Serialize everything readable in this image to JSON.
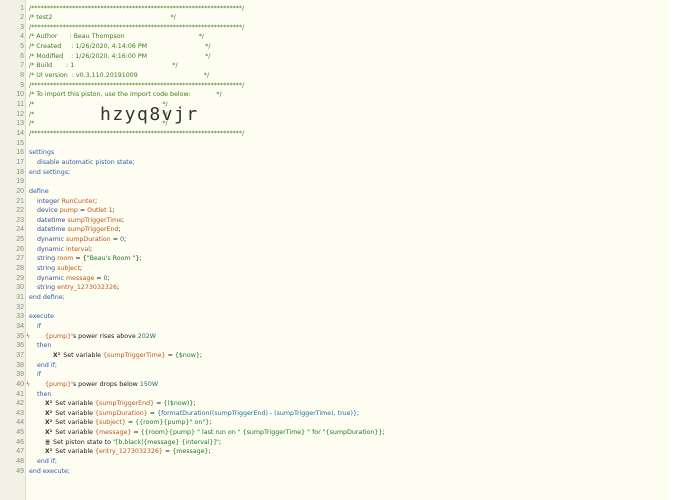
{
  "import_code": "hzyq8vjr",
  "lines": [
    {
      "n": "1",
      "text": "/*******************************************************************/",
      "cls": "cm"
    },
    {
      "n": "2",
      "text": "/* test2                                                           */",
      "cls": "cm"
    },
    {
      "n": "3",
      "text": "/*******************************************************************/",
      "cls": "cm"
    },
    {
      "n": "4",
      "text": "/* Author      : Beau Thompson                                     */",
      "cls": "cm"
    },
    {
      "n": "5",
      "text": "/* Created     : 1/26/2020, 4:14:06 PM                             */",
      "cls": "cm"
    },
    {
      "n": "6",
      "text": "/* Modified    : 1/26/2020, 4:16:00 PM                             */",
      "cls": "cm"
    },
    {
      "n": "7",
      "text": "/* Build       : 1                                                 */",
      "cls": "cm"
    },
    {
      "n": "8",
      "text": "/* UI version  : v0.3.110.20191009                                 */",
      "cls": "cm"
    },
    {
      "n": "9",
      "text": "/*******************************************************************/",
      "cls": "cm"
    },
    {
      "n": "10",
      "text": "/* To import this piston, use the import code below:             */",
      "cls": "cm"
    },
    {
      "n": "11",
      "text": "/*                                                                */",
      "cls": "cm"
    },
    {
      "n": "12",
      "text": "/*                                                                */",
      "cls": "cm"
    },
    {
      "n": "13",
      "text": "/*                                                                */",
      "cls": "cm"
    },
    {
      "n": "14",
      "text": "/*******************************************************************/",
      "cls": "cm"
    },
    {
      "n": "15",
      "text": "",
      "cls": ""
    },
    {
      "n": "16",
      "text": "settings",
      "cls": "kw"
    },
    {
      "n": "17",
      "text": "    disable automatic piston state;",
      "cls": "kw"
    },
    {
      "n": "18",
      "text": "end settings;",
      "cls": "kw"
    },
    {
      "n": "19",
      "text": "",
      "cls": ""
    },
    {
      "n": "20",
      "text": "define",
      "cls": "kw"
    },
    {
      "n": "21",
      "parts": [
        [
          "    integer ",
          "ty"
        ],
        [
          "RunCunter",
          "va"
        ],
        [
          ";",
          ""
        ]
      ]
    },
    {
      "n": "22",
      "parts": [
        [
          "    device ",
          "ty"
        ],
        [
          "pump",
          "va"
        ],
        [
          " = ",
          ""
        ],
        [
          "Outlet 1",
          "va"
        ],
        [
          ";",
          ""
        ]
      ]
    },
    {
      "n": "23",
      "parts": [
        [
          "    datetime ",
          "ty"
        ],
        [
          "sumpTriggerTime",
          "va"
        ],
        [
          ";",
          ""
        ]
      ]
    },
    {
      "n": "24",
      "parts": [
        [
          "    datetime ",
          "ty"
        ],
        [
          "sumpTriggerEnd",
          "va"
        ],
        [
          ";",
          ""
        ]
      ]
    },
    {
      "n": "25",
      "parts": [
        [
          "    dynamic ",
          "ty"
        ],
        [
          "sumpDuration",
          "va"
        ],
        [
          " = ",
          ""
        ],
        [
          "0",
          "nu"
        ],
        [
          ";",
          ""
        ]
      ]
    },
    {
      "n": "26",
      "parts": [
        [
          "    dynamic ",
          "ty"
        ],
        [
          "interval",
          "va"
        ],
        [
          ";",
          ""
        ]
      ]
    },
    {
      "n": "27",
      "parts": [
        [
          "    string ",
          "ty"
        ],
        [
          "room",
          "va"
        ],
        [
          " = {",
          ""
        ],
        [
          "\"Beau's Room \"",
          "st"
        ],
        [
          "};",
          ""
        ]
      ]
    },
    {
      "n": "28",
      "parts": [
        [
          "    string ",
          "ty"
        ],
        [
          "subject",
          "va"
        ],
        [
          ";",
          ""
        ]
      ]
    },
    {
      "n": "29",
      "parts": [
        [
          "    dynamic ",
          "ty"
        ],
        [
          "message",
          "va"
        ],
        [
          " = ",
          ""
        ],
        [
          "0",
          "nu"
        ],
        [
          ";",
          ""
        ]
      ]
    },
    {
      "n": "30",
      "parts": [
        [
          "    string ",
          "ty"
        ],
        [
          "entry_1273032326",
          "va"
        ],
        [
          ";",
          ""
        ]
      ]
    },
    {
      "n": "31",
      "text": "end define;",
      "cls": "kw"
    },
    {
      "n": "32",
      "text": "",
      "cls": ""
    },
    {
      "n": "33",
      "text": "execute",
      "cls": "kw"
    },
    {
      "n": "34",
      "text": "    if",
      "cls": "kw"
    },
    {
      "n": "35",
      "mark": "ϟ",
      "parts": [
        [
          "        {pump}",
          "va"
        ],
        [
          "'s power rises above ",
          ""
        ],
        [
          "202W",
          "nu"
        ]
      ]
    },
    {
      "n": "36",
      "text": "    then",
      "cls": "kw"
    },
    {
      "n": "37",
      "icon": "X²",
      "indent": "            ",
      "parts": [
        [
          "Set variable ",
          ""
        ],
        [
          "{sumpTriggerTime}",
          "va"
        ],
        [
          " = ",
          ""
        ],
        [
          "{$now}",
          "st"
        ],
        [
          ";",
          ""
        ]
      ]
    },
    {
      "n": "38",
      "text": "    end if;",
      "cls": "kw"
    },
    {
      "n": "39",
      "text": "    if",
      "cls": "kw"
    },
    {
      "n": "40",
      "mark": "ϟ",
      "parts": [
        [
          "        {pump}",
          "va"
        ],
        [
          "'s power drops below ",
          ""
        ],
        [
          "150W",
          "nu"
        ]
      ]
    },
    {
      "n": "41",
      "text": "    then",
      "cls": "kw"
    },
    {
      "n": "42",
      "icon": "X²",
      "indent": "        ",
      "parts": [
        [
          "Set variable ",
          ""
        ],
        [
          "{sumpTriggerEnd}",
          "va"
        ],
        [
          " = ",
          ""
        ],
        [
          "{($now)}",
          "st"
        ],
        [
          ";",
          ""
        ]
      ]
    },
    {
      "n": "43",
      "icon": "X²",
      "indent": "        ",
      "parts": [
        [
          "Set variable ",
          ""
        ],
        [
          "{sumpDuration}",
          "va"
        ],
        [
          " = ",
          ""
        ],
        [
          "{formatDuration((sumpTriggerEnd) - (sumpTriggerTime), true)}",
          "fn"
        ],
        [
          ";",
          ""
        ]
      ]
    },
    {
      "n": "44",
      "icon": "X²",
      "indent": "        ",
      "parts": [
        [
          "Set variable ",
          ""
        ],
        [
          "{subject}",
          "va"
        ],
        [
          " = ",
          ""
        ],
        [
          "{{room}{pump}\" on\"}",
          "st"
        ],
        [
          ";",
          ""
        ]
      ]
    },
    {
      "n": "45",
      "icon": "X²",
      "indent": "        ",
      "parts": [
        [
          "Set variable ",
          ""
        ],
        [
          "{message}",
          "va"
        ],
        [
          " = ",
          ""
        ],
        [
          "{{room}{pump} \" last run on \" {sumpTriggerTime} \" for \"{sumpDuration}}",
          "st"
        ],
        [
          ";",
          ""
        ]
      ]
    },
    {
      "n": "46",
      "icon": "≣",
      "indent": "        ",
      "parts": [
        [
          "Set piston state to ",
          ""
        ],
        [
          "\"[b,black|{message} {interval}]\"",
          "st"
        ],
        [
          ";",
          ""
        ]
      ]
    },
    {
      "n": "47",
      "icon": "X²",
      "indent": "        ",
      "parts": [
        [
          "Set variable ",
          ""
        ],
        [
          "{entry_1273032326}",
          "va"
        ],
        [
          " = ",
          ""
        ],
        [
          "{message}",
          "st"
        ],
        [
          ";",
          ""
        ]
      ]
    },
    {
      "n": "48",
      "text": "    end if;",
      "cls": "kw"
    },
    {
      "n": "49",
      "text": "end execute;",
      "cls": "kw"
    }
  ]
}
